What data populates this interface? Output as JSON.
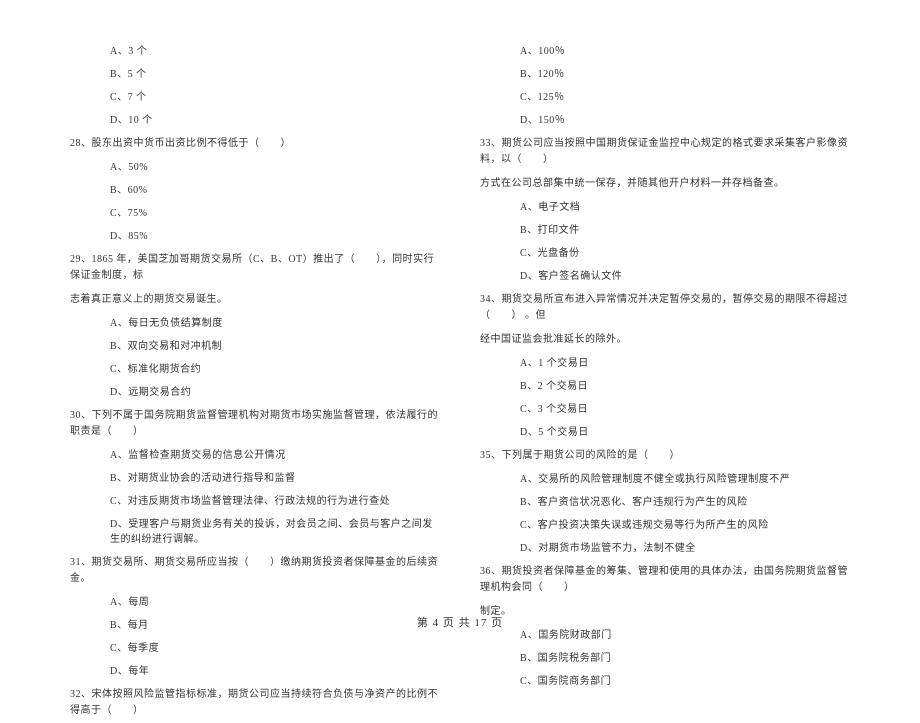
{
  "left": {
    "q27_options": {
      "a": "A、3 个",
      "b": "B、5 个",
      "c": "C、7 个",
      "d": "D、10 个"
    },
    "q28": {
      "text": "28、股东出资中货币出资比例不得低于（　　）",
      "a": "A、50%",
      "b": "B、60%",
      "c": "C、75%",
      "d": "D、85%"
    },
    "q29": {
      "text": "29、1865 年，美国芝加哥期货交易所（C、B、OT）推出了（　　），同时实行保证金制度，标",
      "text2": "志着真正意义上的期货交易诞生。",
      "a": "A、每日无负债结算制度",
      "b": "B、双向交易和对冲机制",
      "c": "C、标准化期货合约",
      "d": "D、远期交易合约"
    },
    "q30": {
      "text": "30、下列不属于国务院期货监督管理机构对期货市场实施监督管理，依法履行的职责是（　　）",
      "a": "A、监督检查期货交易的信息公开情况",
      "b": "B、对期货业协会的活动进行指导和监督",
      "c": "C、对违反期货市场监督管理法律、行政法规的行为进行查处",
      "d": "D、受理客户与期货业务有关的投诉，对会员之间、会员与客户之间发生的纠纷进行调解。"
    },
    "q31": {
      "text": "31、期货交易所、期货交易所应当按（　　）缴纳期货投资者保障基金的后续资金。",
      "a": "A、每周",
      "b": "B、每月",
      "c": "C、每季度",
      "d": "D、每年"
    },
    "q32": {
      "text": "32、宋体按照风险监管指标标准，期货公司应当持续符合负债与净资产的比例不得高于（　　）"
    }
  },
  "right": {
    "q32_options": {
      "a": "A、100％",
      "b": "B、120％",
      "c": "C、125％",
      "d": "D、150％"
    },
    "q33": {
      "text": "33、期货公司应当按照中国期货保证金监控中心规定的格式要求采集客户影像资料，以（　　）",
      "text2": "方式在公司总部集中统一保存，并随其他开户材料一并存档备查。",
      "a": "A、电子文档",
      "b": "B、打印文件",
      "c": "C、光盘备份",
      "d": "D、客户签名确认文件"
    },
    "q34": {
      "text": "34、期货交易所宣布进入异常情况并决定暂停交易的，暂停交易的期限不得超过（　　） 。但",
      "text2": "经中国证监会批准延长的除外。",
      "a": "A、1 个交易日",
      "b": "B、2 个交易日",
      "c": "C、3 个交易日",
      "d": "D、5 个交易日"
    },
    "q35": {
      "text": "35、下列属于期货公司的风险的是（　　）",
      "a": "A、交易所的风险管理制度不健全或执行风险管理制度不严",
      "b": "B、客户资信状况恶化、客户违规行为产生的风险",
      "c": "C、客户投资决策失误或违规交易等行为所产生的风险",
      "d": "D、对期货市场监管不力，法制不健全"
    },
    "q36": {
      "text": "36、期货投资者保障基金的筹集、管理和使用的具体办法，由国务院期货监督管理机构会同（　　）",
      "text2": "制定。",
      "a": "A、国务院财政部门",
      "b": "B、国务院税务部门",
      "c": "C、国务院商务部门"
    }
  },
  "footer": "第 4 页 共 17 页"
}
